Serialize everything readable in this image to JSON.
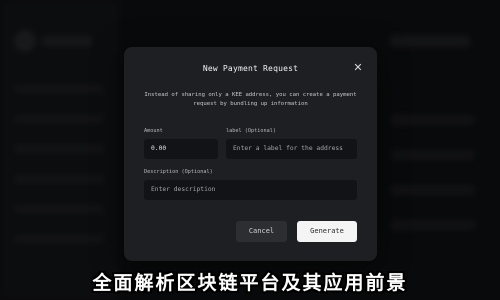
{
  "modal": {
    "title": "New Payment Request",
    "close_glyph": "✕",
    "description": "Instead of sharing only a KEE address, you can create a payment request by bundling up information",
    "amount_label": "Amount",
    "amount_value": "0.00",
    "label_label": "label (Optional)",
    "label_placeholder": "Enter a label for the address",
    "description_label": "Description (Optional)",
    "description_placeholder": "Enter description",
    "cancel_label": "Cancel",
    "generate_label": "Generate"
  },
  "caption": "全面解析区块链平台及其应用前景"
}
